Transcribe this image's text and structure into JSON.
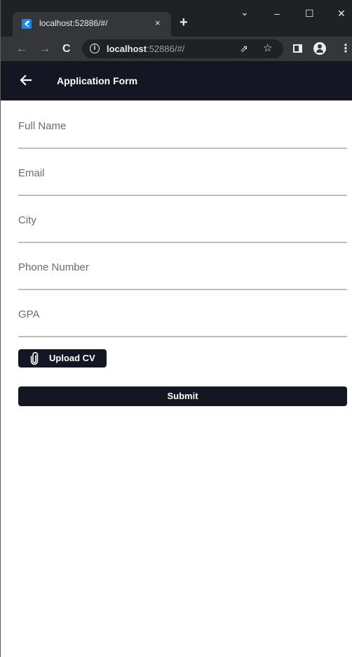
{
  "browser": {
    "tab_title": "localhost:52886/#/",
    "tab_close": "×",
    "new_tab": "+",
    "controls": {
      "dropdown": "⌄",
      "minimize": "–",
      "maximize": "☐",
      "close": "✕"
    },
    "url_host": "localhost",
    "url_path": ":52886/#/",
    "icons": [
      "back-icon",
      "forward-icon",
      "reload-icon",
      "info-icon",
      "share-icon",
      "star-icon",
      "sidepanel-icon",
      "profile-icon",
      "menu-icon"
    ]
  },
  "appbar": {
    "title": "Application Form"
  },
  "form": {
    "fields": [
      {
        "placeholder": "Full Name",
        "value": ""
      },
      {
        "placeholder": "Email",
        "value": ""
      },
      {
        "placeholder": "City",
        "value": ""
      },
      {
        "placeholder": "Phone Number",
        "value": ""
      },
      {
        "placeholder": "GPA",
        "value": ""
      }
    ],
    "upload_label": "Upload CV",
    "submit_label": "Submit"
  },
  "colors": {
    "primary": "#141624",
    "chrome_dark": "#202124",
    "chrome_toolbar": "#35363a",
    "divider": "#bdbdbd"
  }
}
